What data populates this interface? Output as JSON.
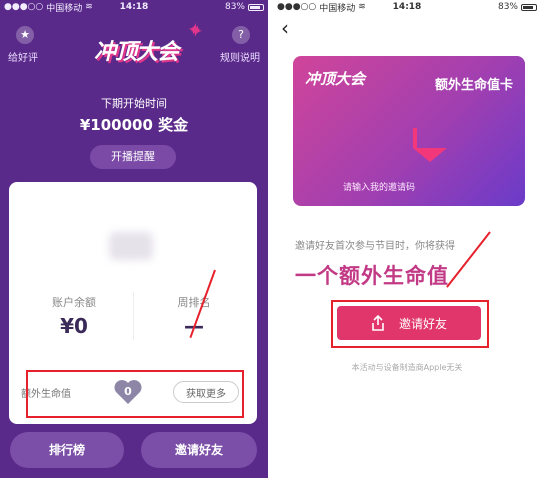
{
  "left": {
    "status": {
      "carrier": "中国移动",
      "time": "14:18",
      "battery": "83%"
    },
    "header": {
      "star_icon": "★",
      "review_label": "给好评",
      "help_icon": "?",
      "rules_label": "规则说明",
      "logo_text": "冲顶大会"
    },
    "next_time_label": "下期开始时间",
    "prize_text": "¥100000 奖金",
    "remind_label": "开播提醒",
    "stats": {
      "balance_label": "账户余额",
      "balance_value": "¥0",
      "rank_label": "周排名",
      "rank_value": "—"
    },
    "extra_life": {
      "label": "额外生命值",
      "count": "0",
      "more_label": "获取更多"
    },
    "buttons": {
      "ranking": "排行榜",
      "invite": "邀请好友"
    },
    "colors": {
      "bg": "#5a2a8a",
      "accent": "#e0368c",
      "annotation": "#e6212c"
    }
  },
  "right": {
    "status": {
      "carrier": "中国移动",
      "time": "14:18",
      "battery": "83%"
    },
    "back_icon": "‹",
    "card": {
      "logo_text": "冲顶大会",
      "title": "额外生命值卡",
      "placeholder": "请输入我的邀请码"
    },
    "invite_text": "邀请好友首次参与节目时，你将获得",
    "extra_life_text": "一个额外生命值",
    "invite_button": "邀请好友",
    "footnote": "本活动与设备制造商Apple无关",
    "colors": {
      "button": "#e0366b",
      "highlight": "#c23a86"
    }
  }
}
